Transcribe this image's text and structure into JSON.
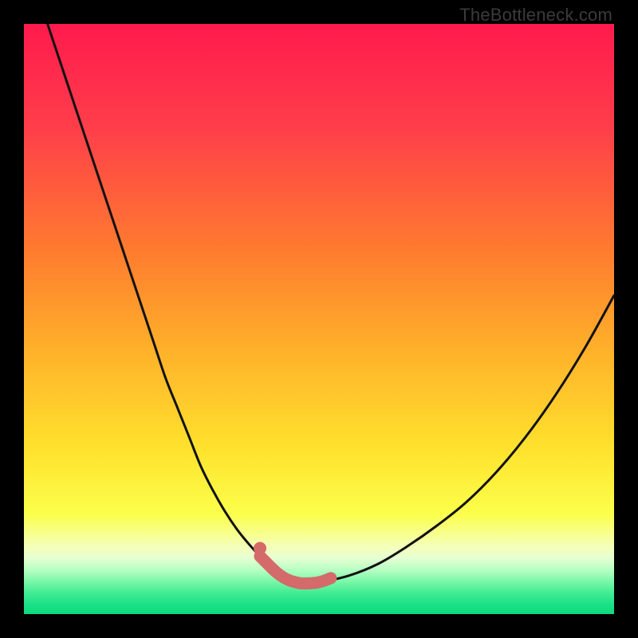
{
  "watermark": "TheBottleneck.com",
  "colors": {
    "frame": "#000000",
    "curve": "#111111",
    "marker": "#d46a6a",
    "gradient_stops": [
      {
        "pos": 0.0,
        "color": "#ff1a4d"
      },
      {
        "pos": 0.18,
        "color": "#ff3f4a"
      },
      {
        "pos": 0.38,
        "color": "#ff7a2f"
      },
      {
        "pos": 0.55,
        "color": "#ffb02a"
      },
      {
        "pos": 0.72,
        "color": "#ffe22d"
      },
      {
        "pos": 0.83,
        "color": "#fbff4a"
      },
      {
        "pos": 0.885,
        "color": "#f5ffb8"
      },
      {
        "pos": 0.905,
        "color": "#e6ffd2"
      },
      {
        "pos": 0.926,
        "color": "#b4ffc2"
      },
      {
        "pos": 0.945,
        "color": "#7af7a8"
      },
      {
        "pos": 0.965,
        "color": "#3feb93"
      },
      {
        "pos": 0.985,
        "color": "#18e085"
      },
      {
        "pos": 1.0,
        "color": "#0fd97d"
      }
    ]
  },
  "chart_data": {
    "type": "line",
    "title": "",
    "xlabel": "",
    "ylabel": "",
    "xlim": [
      0,
      100
    ],
    "ylim": [
      0,
      100
    ],
    "grid": false,
    "legend": false,
    "series": [
      {
        "name": "bottleneck_curve",
        "x": [
          4,
          6,
          8,
          10,
          12,
          14,
          16,
          18,
          20,
          22,
          24,
          26,
          28,
          30,
          32,
          34,
          36,
          38,
          40,
          42,
          44,
          45,
          47,
          50,
          55,
          60,
          65,
          70,
          75,
          80,
          85,
          90,
          95,
          100
        ],
        "y": [
          100,
          94,
          88,
          82,
          76,
          70,
          64,
          58,
          52,
          46,
          40,
          35,
          30,
          25,
          21,
          17.5,
          14.5,
          12,
          9.8,
          7.8,
          6.2,
          5.5,
          5.2,
          5.4,
          6.5,
          8.5,
          11.5,
          15,
          19,
          24,
          30,
          37,
          45,
          54
        ]
      },
      {
        "name": "flat_bottom_marker",
        "x": [
          40,
          41,
          42,
          43,
          44,
          45,
          46,
          47,
          48,
          49,
          50,
          51,
          52
        ],
        "y": [
          9.8,
          8.8,
          7.8,
          6.9,
          6.2,
          5.7,
          5.4,
          5.2,
          5.2,
          5.25,
          5.4,
          5.7,
          6.1
        ]
      }
    ],
    "annotations": [
      {
        "text": "TheBottleneck.com",
        "position": "top-right"
      }
    ]
  }
}
